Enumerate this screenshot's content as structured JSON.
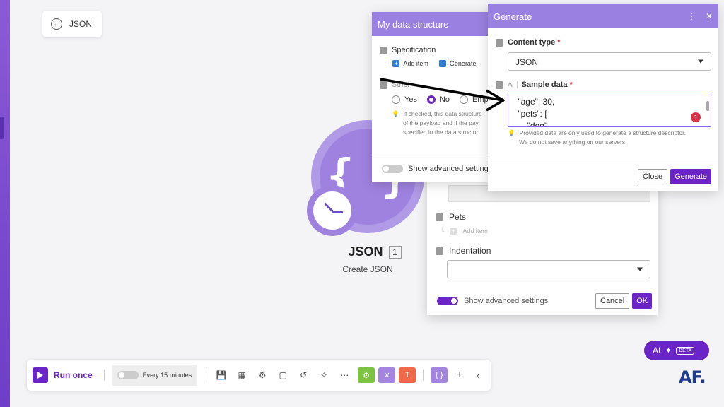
{
  "back": {
    "label": "JSON"
  },
  "module": {
    "icon_glyph": "{ }",
    "name": "JSON",
    "count": "1",
    "subtitle": "Create JSON"
  },
  "json_settings": {
    "pets_label": "Pets",
    "add_item_label": "Add item",
    "indentation_label": "Indentation",
    "indentation_value": "",
    "advanced_label": "Show advanced settings",
    "cancel_label": "Cancel",
    "ok_label": "OK"
  },
  "data_structure": {
    "title": "My data structure",
    "specification_label": "Specification",
    "add_item_label": "Add item",
    "generate_label": "Generate",
    "strict_label": "Strict",
    "radio_options": [
      "Yes",
      "No",
      "Empty"
    ],
    "radio_selected": "No",
    "help_lines": [
      "If checked, this data structure",
      "of the payload and if the payl",
      "specified in the data structur"
    ],
    "advanced_label": "Show advanced settings"
  },
  "generate_dialog": {
    "title": "Generate",
    "content_type_label": "Content type",
    "content_type_value": "JSON",
    "sample_data_label": "Sample data",
    "sample_lines": [
      "    \"age\": 30,",
      "    \"pets\": [",
      "        \"dog\""
    ],
    "error_count": "1",
    "note_lines": [
      "Provided data are only used to generate a structure descriptor.",
      "We do not save anything on our servers."
    ],
    "close_label": "Close",
    "generate_label": "Generate",
    "required_mark": "*"
  },
  "toolbar": {
    "run_label": "Run once",
    "schedule_label": "Every 15 minutes",
    "sq1_color": "#7dc243",
    "sq2_color": "#a385e0",
    "sq3_color": "#f06a4a",
    "sq4_color": "#a385e0"
  },
  "ai": {
    "label": "AI",
    "badge": "BETA"
  },
  "watermark": "AF."
}
